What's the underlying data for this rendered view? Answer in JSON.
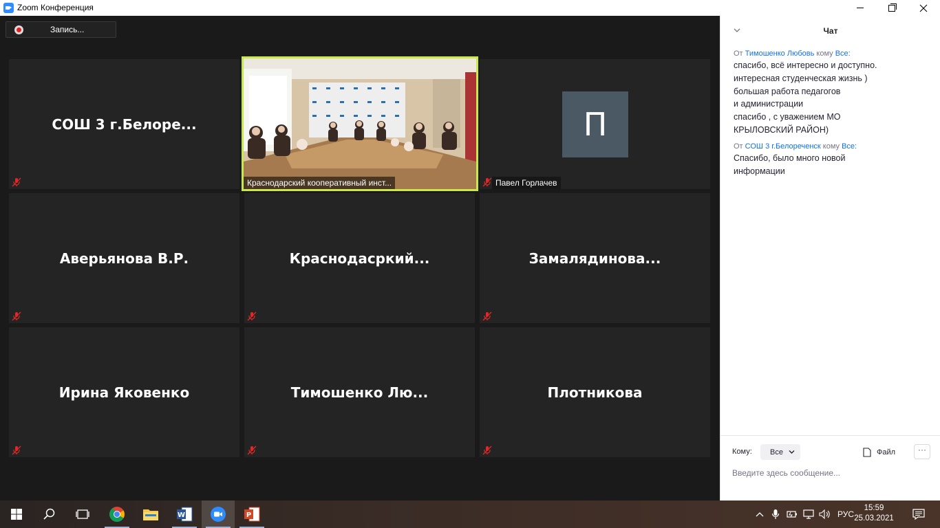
{
  "window": {
    "title": "Zoom Конференция"
  },
  "recording": {
    "label": "Запись..."
  },
  "tiles": [
    {
      "name": "СОШ 3  г.Белоре...",
      "muted": true
    },
    {
      "label": "Краснодарский кооперативный инст...",
      "muted": false,
      "active": true
    },
    {
      "label": "Павел Горлачев",
      "avatar_letter": "П",
      "muted": true
    },
    {
      "name": "Аверьянова В.Р.",
      "muted": true
    },
    {
      "name": "Краснодасркий...",
      "muted": true
    },
    {
      "name": "Замалядинова...",
      "muted": true
    },
    {
      "name": "Ирина Яковенко",
      "muted": true
    },
    {
      "name": "Тимошенко  Лю...",
      "muted": true
    },
    {
      "name": "Плотникова",
      "muted": true
    }
  ],
  "chat": {
    "title": "Чат",
    "messages": [
      {
        "from_prefix": "От",
        "sender": "Тимошенко Любовь",
        "to_word": "кому",
        "recipient": "Все:",
        "text": "спасибо, всё интересно и доступно.\nинтересная студенческая жизнь )\nбольшая работа педагогов\nи администрации\nспасибо , с уважением МО\nКРЫЛОВСКИЙ РАЙОН)"
      },
      {
        "from_prefix": "От",
        "sender": "СОШ 3 г.Белореченск",
        "to_word": "кому",
        "recipient": "Все:",
        "text": "Спасибо, было много новой\nинформации"
      }
    ],
    "to_label": "Кому:",
    "to_value": "Все",
    "file_label": "Файл",
    "more_label": "···",
    "input_placeholder": "Введите здесь сообщение..."
  },
  "taskbar": {
    "language": "РУС",
    "time": "15:59",
    "date": "25.03.2021"
  },
  "colors": {
    "active_speaker_border": "#c9e94a",
    "chat_link": "#0e71eb",
    "tile_bg": "#242424",
    "avatar_bg": "#4a5964"
  }
}
